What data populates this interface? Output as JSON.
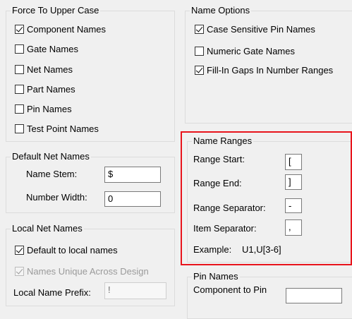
{
  "force_upper": {
    "title": "Force To Upper Case",
    "options": [
      {
        "label": "Component Names",
        "checked": true
      },
      {
        "label": "Gate Names",
        "checked": false
      },
      {
        "label": "Net Names",
        "checked": false
      },
      {
        "label": "Part Names",
        "checked": false
      },
      {
        "label": "Pin Names",
        "checked": false
      },
      {
        "label": "Test Point Names",
        "checked": false
      }
    ]
  },
  "name_options": {
    "title": "Name Options",
    "options": [
      {
        "label": "Case Sensitive Pin Names",
        "checked": true
      },
      {
        "label": "Numeric Gate Names",
        "checked": false
      },
      {
        "label": "Fill-In Gaps In Number Ranges",
        "checked": true
      }
    ]
  },
  "default_net_names": {
    "title": "Default Net Names",
    "name_stem_label": "Name Stem:",
    "name_stem_value": "$",
    "number_width_label": "Number Width:",
    "number_width_value": "0"
  },
  "name_ranges": {
    "title": "Name Ranges",
    "range_start_label": "Range Start:",
    "range_start_value": "[",
    "range_end_label": "Range End:",
    "range_end_value": "]",
    "range_separator_label": "Range Separator:",
    "range_separator_value": "-",
    "item_separator_label": "Item Separator:",
    "item_separator_value": ",",
    "example_label": "Example:",
    "example_value": "U1,U[3-6]",
    "highlight_color": "#e8141c"
  },
  "local_net_names": {
    "title": "Local Net Names",
    "default_local_label": "Default to local names",
    "default_local_checked": true,
    "unique_label": "Names Unique Across Design",
    "unique_checked": true,
    "prefix_label": "Local Name Prefix:",
    "prefix_value": "!"
  },
  "pin_names": {
    "title": "Pin Names",
    "component_to_pin_label": "Component to Pin",
    "component_to_pin_value": ""
  }
}
